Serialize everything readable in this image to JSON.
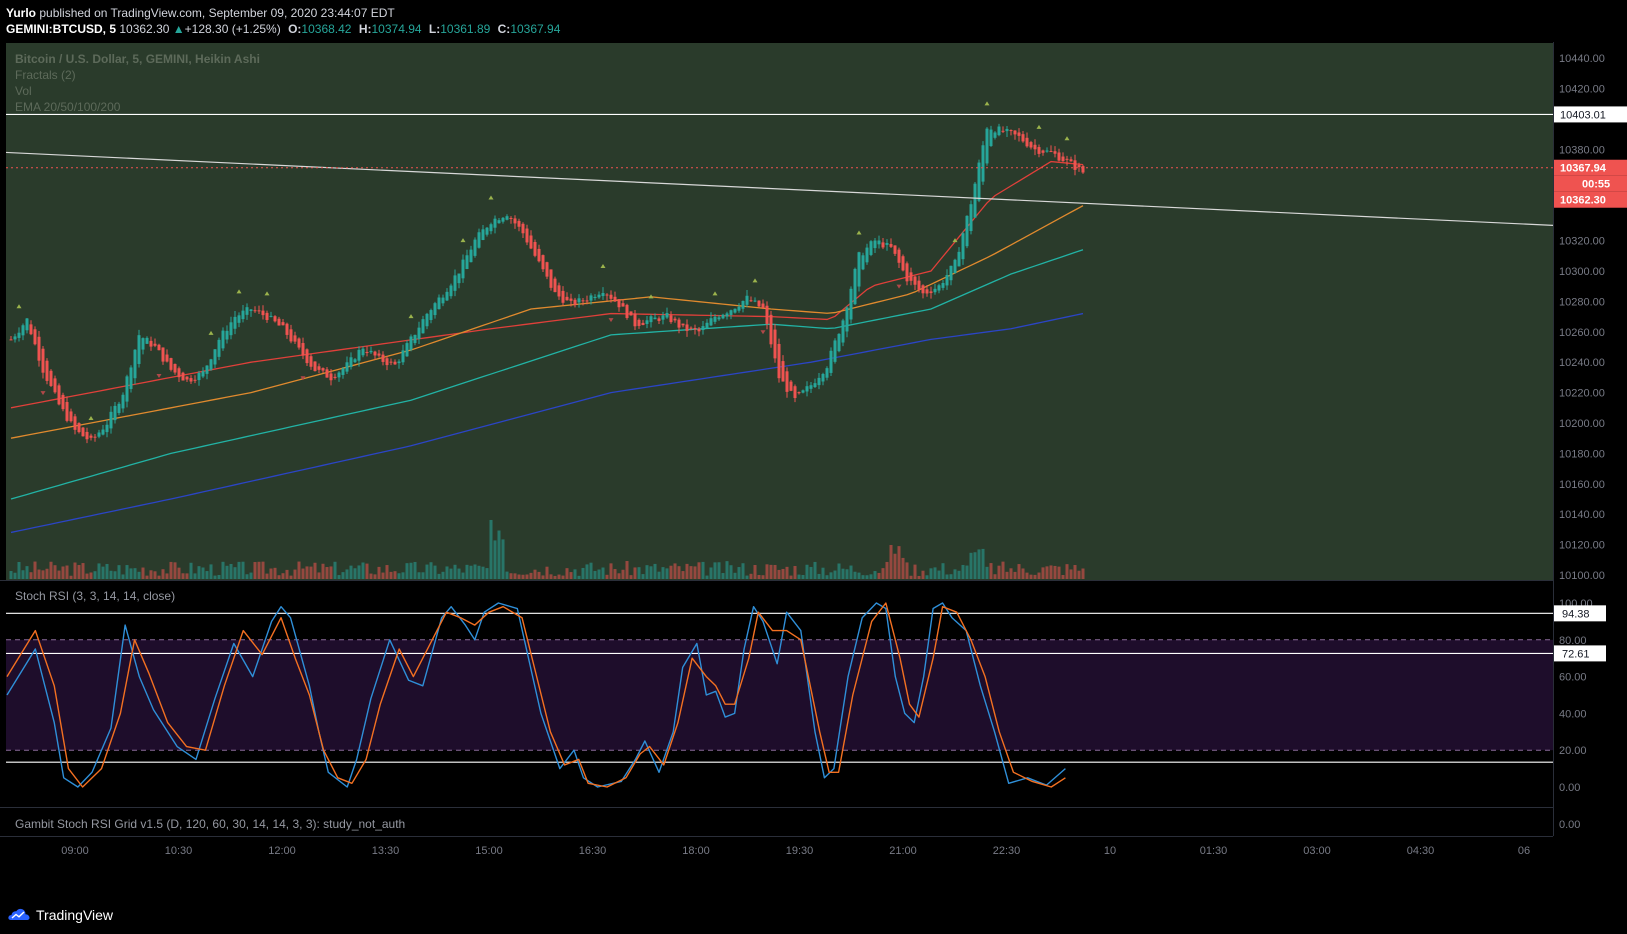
{
  "header": {
    "author": "Yurlo",
    "published": "published on TradingView.com, September 09, 2020 23:44:07 EDT",
    "symbol": "GEMINI:BTCUSD, 5",
    "price": "10362.30",
    "change": "+128.30 (+1.25%)",
    "open_label": "O:",
    "open": "10368.42",
    "high_label": "H:",
    "high": "10374.94",
    "low_label": "L:",
    "low": "10361.89",
    "close_label": "C:",
    "close": "10367.94"
  },
  "legend": {
    "title": "Bitcoin / U.S. Dollar, 5, GEMINI, Heikin Ashi",
    "items": [
      "Fractals (2)",
      "Vol",
      "EMA 20/50/100/200"
    ]
  },
  "sub_panels": {
    "stoch_label": "Stoch RSI (3, 3, 14, 14, close)",
    "grid_label": "Gambit Stoch RSI Grid v1.5 (D, 120, 60, 30, 14, 14, 3, 3): study_not_auth",
    "grid_tick": "0.00"
  },
  "price_labels": {
    "resistance": "10403.01",
    "last": "10367.94",
    "countdown": "00:55",
    "current": "10362.30",
    "stoch_upper": "94.38",
    "stoch_lower": "72.61"
  },
  "footer": {
    "brand": "TradingView"
  },
  "colors": {
    "up": "#26a69a",
    "down": "#ef5350",
    "pane_bg": "#2a3b2b",
    "stoch_band": "#1e0d2b",
    "ema20": "#e0403a",
    "ema50": "#e08a2e",
    "ema100": "#22b3a5",
    "ema200": "#2b45c6",
    "k_line": "#2f8fd8",
    "d_line": "#f37021"
  },
  "chart_data": [
    {
      "type": "candlestick",
      "series_name": "Bitcoin / U.S. Dollar, 5, GEMINI, Heikin Ashi",
      "x_ticks": [
        "09:00",
        "10:30",
        "12:00",
        "13:30",
        "15:00",
        "16:30",
        "18:00",
        "19:30",
        "21:00",
        "22:30",
        "10",
        "01:30",
        "03:00",
        "04:30",
        "06"
      ],
      "ylim": [
        10100,
        10450
      ],
      "y_ticks": [
        10100,
        10120,
        10140,
        10160,
        10180,
        10200,
        10220,
        10240,
        10260,
        10280,
        10300,
        10320,
        10340,
        10360,
        10380,
        10400,
        10420,
        10440
      ],
      "y_tick_labels": [
        "10100.00",
        "10120.00",
        "10140.00",
        "10160.00",
        "10180.00",
        "10200.00",
        "10220.00",
        "10240.00",
        "10260.00",
        "10280.00",
        "10300.00",
        "10320.00",
        "",
        "",
        "10380.00",
        "",
        "10420.00",
        "10440.00"
      ],
      "close_path": [
        [
          0,
          10255
        ],
        [
          4,
          10268
        ],
        [
          8,
          10235
        ],
        [
          12,
          10212
        ],
        [
          16,
          10195
        ],
        [
          20,
          10188
        ],
        [
          24,
          10200
        ],
        [
          28,
          10220
        ],
        [
          32,
          10258
        ],
        [
          36,
          10250
        ],
        [
          40,
          10235
        ],
        [
          44,
          10228
        ],
        [
          48,
          10233
        ],
        [
          52,
          10255
        ],
        [
          56,
          10270
        ],
        [
          60,
          10275
        ],
        [
          64,
          10270
        ],
        [
          68,
          10262
        ],
        [
          72,
          10248
        ],
        [
          76,
          10235
        ],
        [
          80,
          10230
        ],
        [
          84,
          10238
        ],
        [
          88,
          10250
        ],
        [
          92,
          10242
        ],
        [
          96,
          10238
        ],
        [
          100,
          10255
        ],
        [
          104,
          10272
        ],
        [
          108,
          10285
        ],
        [
          112,
          10300
        ],
        [
          116,
          10320
        ],
        [
          120,
          10333
        ],
        [
          124,
          10338
        ],
        [
          128,
          10325
        ],
        [
          132,
          10305
        ],
        [
          136,
          10285
        ],
        [
          140,
          10278
        ],
        [
          144,
          10282
        ],
        [
          148,
          10288
        ],
        [
          152,
          10278
        ],
        [
          156,
          10265
        ],
        [
          160,
          10268
        ],
        [
          164,
          10270
        ],
        [
          168,
          10262
        ],
        [
          172,
          10260
        ],
        [
          176,
          10270
        ],
        [
          180,
          10275
        ],
        [
          184,
          10282
        ],
        [
          188,
          10275
        ],
        [
          192,
          10230
        ],
        [
          196,
          10215
        ],
        [
          200,
          10225
        ],
        [
          204,
          10238
        ],
        [
          208,
          10268
        ],
        [
          212,
          10310
        ],
        [
          216,
          10320
        ],
        [
          220,
          10315
        ],
        [
          224,
          10295
        ],
        [
          228,
          10285
        ],
        [
          232,
          10290
        ],
        [
          236,
          10305
        ],
        [
          240,
          10345
        ],
        [
          244,
          10395
        ],
        [
          248,
          10392
        ],
        [
          252,
          10388
        ],
        [
          256,
          10380
        ],
        [
          260,
          10378
        ],
        [
          264,
          10372
        ],
        [
          268,
          10365
        ]
      ],
      "resistance_level": 10403.01,
      "trendline": [
        [
          0,
          10378
        ],
        [
          1076,
          10330
        ]
      ],
      "ema20": [
        [
          0,
          10210
        ],
        [
          60,
          10240
        ],
        [
          120,
          10262
        ],
        [
          150,
          10272
        ],
        [
          190,
          10270
        ],
        [
          205,
          10268
        ],
        [
          215,
          10290
        ],
        [
          230,
          10300
        ],
        [
          245,
          10348
        ],
        [
          260,
          10372
        ],
        [
          268,
          10370
        ]
      ],
      "ema50": [
        [
          0,
          10190
        ],
        [
          60,
          10220
        ],
        [
          100,
          10248
        ],
        [
          130,
          10275
        ],
        [
          160,
          10283
        ],
        [
          190,
          10275
        ],
        [
          205,
          10272
        ],
        [
          225,
          10285
        ],
        [
          245,
          10310
        ],
        [
          268,
          10343
        ]
      ],
      "ema100": [
        [
          0,
          10150
        ],
        [
          40,
          10180
        ],
        [
          100,
          10215
        ],
        [
          150,
          10258
        ],
        [
          190,
          10265
        ],
        [
          205,
          10262
        ],
        [
          230,
          10275
        ],
        [
          250,
          10298
        ],
        [
          268,
          10314
        ]
      ],
      "ema200": [
        [
          0,
          10128
        ],
        [
          40,
          10150
        ],
        [
          100,
          10185
        ],
        [
          150,
          10220
        ],
        [
          200,
          10240
        ],
        [
          230,
          10255
        ],
        [
          250,
          10262
        ],
        [
          268,
          10272
        ]
      ],
      "volume_peaks": [
        [
          30,
          45
        ],
        [
          55,
          24
        ],
        [
          60,
          21
        ],
        [
          85,
          35
        ],
        [
          95,
          20
        ],
        [
          104,
          86
        ],
        [
          110,
          21
        ],
        [
          135,
          55
        ],
        [
          180,
          30
        ],
        [
          210,
          20
        ],
        [
          218,
          42
        ],
        [
          240,
          28
        ]
      ],
      "fractals_up_at": [
        2,
        20,
        50,
        57,
        64,
        100,
        113,
        120,
        148,
        160,
        176,
        186,
        212,
        236,
        244,
        257,
        264
      ],
      "fractals_down_at": [
        8,
        37,
        73,
        150,
        188,
        222
      ]
    },
    {
      "type": "line",
      "title": "Stoch RSI (3, 3, 14, 14, close)",
      "ylim": [
        0,
        100
      ],
      "y_ticks": [
        0,
        20,
        40,
        60,
        80,
        100
      ],
      "y_tick_labels": [
        "0.00",
        "20.00",
        "40.00",
        "60.00",
        "80.00",
        "100.00"
      ],
      "band": [
        20,
        80
      ],
      "levels": [
        94.38,
        72.61,
        13.5
      ],
      "series": [
        {
          "values": [
            [
              0,
              50
            ],
            [
              6,
              75
            ],
            [
              10,
              35
            ],
            [
              12,
              5
            ],
            [
              15,
              0
            ],
            [
              18,
              8
            ],
            [
              22,
              32
            ],
            [
              25,
              88
            ],
            [
              28,
              60
            ],
            [
              31,
              42
            ],
            [
              36,
              22
            ],
            [
              40,
              15
            ],
            [
              44,
              48
            ],
            [
              48,
              78
            ],
            [
              52,
              60
            ],
            [
              56,
              90
            ],
            [
              58,
              98
            ],
            [
              60,
              92
            ],
            [
              64,
              55
            ],
            [
              66,
              30
            ],
            [
              68,
              8
            ],
            [
              72,
              0
            ],
            [
              74,
              15
            ],
            [
              77,
              48
            ],
            [
              81,
              80
            ],
            [
              85,
              58
            ],
            [
              88,
              55
            ],
            [
              92,
              92
            ],
            [
              94,
              98
            ],
            [
              97,
              88
            ],
            [
              99,
              80
            ],
            [
              101,
              95
            ],
            [
              104,
              100
            ],
            [
              108,
              97
            ],
            [
              113,
              40
            ],
            [
              117,
              10
            ],
            [
              120,
              20
            ],
            [
              122,
              5
            ],
            [
              125,
              0
            ],
            [
              130,
              3
            ],
            [
              133,
              15
            ],
            [
              135,
              25
            ],
            [
              138,
              8
            ],
            [
              141,
              30
            ],
            [
              143,
              65
            ],
            [
              146,
              78
            ],
            [
              148,
              50
            ],
            [
              150,
              52
            ],
            [
              152,
              38
            ],
            [
              154,
              40
            ],
            [
              156,
              75
            ],
            [
              158,
              98
            ],
            [
              160,
              90
            ],
            [
              163,
              67
            ],
            [
              165,
              95
            ],
            [
              168,
              85
            ],
            [
              171,
              30
            ],
            [
              173,
              5
            ],
            [
              175,
              10
            ],
            [
              178,
              60
            ],
            [
              181,
              92
            ],
            [
              184,
              100
            ],
            [
              186,
              97
            ],
            [
              188,
              60
            ],
            [
              190,
              40
            ],
            [
              192,
              35
            ],
            [
              194,
              60
            ],
            [
              196,
              97
            ],
            [
              198,
              100
            ],
            [
              200,
              92
            ],
            [
              203,
              85
            ],
            [
              206,
              55
            ],
            [
              209,
              30
            ],
            [
              212,
              2
            ],
            [
              216,
              5
            ],
            [
              220,
              1
            ],
            [
              224,
              10
            ]
          ]
        },
        {
          "values": [
            [
              0,
              60
            ],
            [
              6,
              85
            ],
            [
              10,
              55
            ],
            [
              13,
              10
            ],
            [
              16,
              0
            ],
            [
              20,
              10
            ],
            [
              24,
              40
            ],
            [
              27,
              80
            ],
            [
              30,
              62
            ],
            [
              34,
              35
            ],
            [
              38,
              22
            ],
            [
              42,
              20
            ],
            [
              46,
              55
            ],
            [
              50,
              85
            ],
            [
              54,
              72
            ],
            [
              58,
              92
            ],
            [
              61,
              70
            ],
            [
              64,
              50
            ],
            [
              67,
              20
            ],
            [
              70,
              5
            ],
            [
              73,
              2
            ],
            [
              76,
              15
            ],
            [
              79,
              45
            ],
            [
              83,
              75
            ],
            [
              86,
              60
            ],
            [
              90,
              80
            ],
            [
              93,
              95
            ],
            [
              96,
              92
            ],
            [
              99,
              88
            ],
            [
              102,
              95
            ],
            [
              105,
              98
            ],
            [
              109,
              92
            ],
            [
              115,
              30
            ],
            [
              118,
              12
            ],
            [
              121,
              15
            ],
            [
              123,
              2
            ],
            [
              127,
              0
            ],
            [
              131,
              5
            ],
            [
              134,
              18
            ],
            [
              136,
              22
            ],
            [
              139,
              12
            ],
            [
              142,
              35
            ],
            [
              145,
              70
            ],
            [
              148,
              60
            ],
            [
              150,
              55
            ],
            [
              152,
              45
            ],
            [
              154,
              45
            ],
            [
              157,
              70
            ],
            [
              159,
              95
            ],
            [
              162,
              85
            ],
            [
              165,
              85
            ],
            [
              168,
              80
            ],
            [
              172,
              30
            ],
            [
              174,
              8
            ],
            [
              176,
              8
            ],
            [
              179,
              50
            ],
            [
              183,
              90
            ],
            [
              186,
              100
            ],
            [
              189,
              70
            ],
            [
              191,
              45
            ],
            [
              193,
              38
            ],
            [
              196,
              70
            ],
            [
              198,
              98
            ],
            [
              201,
              95
            ],
            [
              204,
              80
            ],
            [
              207,
              60
            ],
            [
              210,
              30
            ],
            [
              213,
              8
            ],
            [
              217,
              3
            ],
            [
              221,
              0
            ],
            [
              224,
              5
            ]
          ]
        }
      ]
    },
    {
      "type": "line",
      "title": "Gambit Stoch RSI Grid v1.5 (D, 120, 60, 30, 14, 14, 3, 3): study_not_auth",
      "y_ticks": [
        0
      ],
      "y_tick_labels": [
        "0.00"
      ]
    }
  ]
}
